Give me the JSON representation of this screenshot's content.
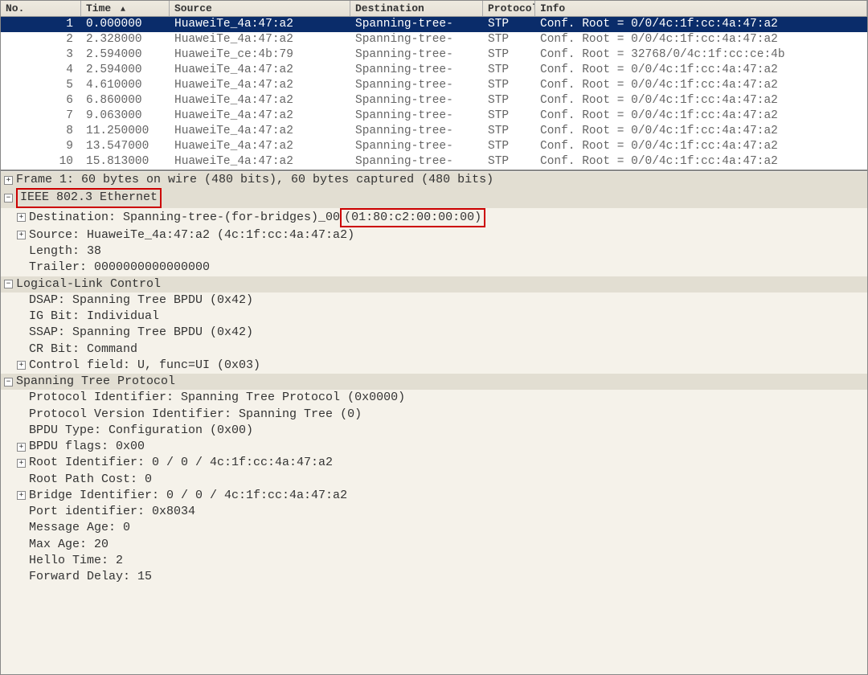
{
  "columns": {
    "no": "No.",
    "time": "Time",
    "source": "Source",
    "destination": "Destination",
    "protocol": "Protocol",
    "info": "Info"
  },
  "packets": [
    {
      "no": "1",
      "time": "0.000000",
      "src": "HuaweiTe_4a:47:a2",
      "dst": "Spanning-tree-",
      "proto": "STP",
      "info": "Conf. Root = 0/0/4c:1f:cc:4a:47:a2",
      "selected": true
    },
    {
      "no": "2",
      "time": "2.328000",
      "src": "HuaweiTe_4a:47:a2",
      "dst": "Spanning-tree-",
      "proto": "STP",
      "info": "Conf. Root = 0/0/4c:1f:cc:4a:47:a2"
    },
    {
      "no": "3",
      "time": "2.594000",
      "src": "HuaweiTe_ce:4b:79",
      "dst": "Spanning-tree-",
      "proto": "STP",
      "info": "Conf. Root = 32768/0/4c:1f:cc:ce:4b"
    },
    {
      "no": "4",
      "time": "2.594000",
      "src": "HuaweiTe_4a:47:a2",
      "dst": "Spanning-tree-",
      "proto": "STP",
      "info": "Conf. Root = 0/0/4c:1f:cc:4a:47:a2"
    },
    {
      "no": "5",
      "time": "4.610000",
      "src": "HuaweiTe_4a:47:a2",
      "dst": "Spanning-tree-",
      "proto": "STP",
      "info": "Conf. Root = 0/0/4c:1f:cc:4a:47:a2"
    },
    {
      "no": "6",
      "time": "6.860000",
      "src": "HuaweiTe_4a:47:a2",
      "dst": "Spanning-tree-",
      "proto": "STP",
      "info": "Conf. Root = 0/0/4c:1f:cc:4a:47:a2"
    },
    {
      "no": "7",
      "time": "9.063000",
      "src": "HuaweiTe_4a:47:a2",
      "dst": "Spanning-tree-",
      "proto": "STP",
      "info": "Conf. Root = 0/0/4c:1f:cc:4a:47:a2"
    },
    {
      "no": "8",
      "time": "11.250000",
      "src": "HuaweiTe_4a:47:a2",
      "dst": "Spanning-tree-",
      "proto": "STP",
      "info": "Conf. Root = 0/0/4c:1f:cc:4a:47:a2"
    },
    {
      "no": "9",
      "time": "13.547000",
      "src": "HuaweiTe_4a:47:a2",
      "dst": "Spanning-tree-",
      "proto": "STP",
      "info": "Conf. Root = 0/0/4c:1f:cc:4a:47:a2"
    },
    {
      "no": "10",
      "time": "15.813000",
      "src": "HuaweiTe_4a:47:a2",
      "dst": "Spanning-tree-",
      "proto": "STP",
      "info": "Conf. Root = 0/0/4c:1f:cc:4a:47:a2"
    }
  ],
  "detail": {
    "frame": "Frame 1: 60 bytes on wire (480 bits), 60 bytes captured (480 bits)",
    "ethernet_label": "IEEE 802.3 Ethernet",
    "eth_dest_pre": "Destination: Spanning-tree-(for-bridges)_00 ",
    "eth_dest_mac": "(01:80:c2:00:00:00)",
    "eth_src": "Source: HuaweiTe_4a:47:a2 (4c:1f:cc:4a:47:a2)",
    "eth_len": "Length: 38",
    "eth_trailer": "Trailer: 0000000000000000",
    "llc_label": "Logical-Link Control",
    "llc_dsap": "DSAP: Spanning Tree BPDU (0x42)",
    "llc_ig": "IG Bit: Individual",
    "llc_ssap": "SSAP: Spanning Tree BPDU (0x42)",
    "llc_cr": "CR Bit: Command",
    "llc_ctrl": "Control field: U, func=UI (0x03)",
    "stp_label": "Spanning Tree Protocol",
    "stp_protoid": "Protocol Identifier: Spanning Tree Protocol (0x0000)",
    "stp_ver": "Protocol Version Identifier: Spanning Tree (0)",
    "stp_bpdutype": "BPDU Type: Configuration (0x00)",
    "stp_flags": "BPDU flags: 0x00",
    "stp_rootid": "Root Identifier: 0 / 0 / 4c:1f:cc:4a:47:a2",
    "stp_rootcost": "Root Path Cost: 0",
    "stp_bridgeid": "Bridge Identifier: 0 / 0 / 4c:1f:cc:4a:47:a2",
    "stp_portid": "Port identifier: 0x8034",
    "stp_msgage": "Message Age: 0",
    "stp_maxage": "Max Age: 20",
    "stp_hello": "Hello Time: 2",
    "stp_fwd": "Forward Delay: 15"
  },
  "glyph": {
    "plus": "+",
    "minus": "−",
    "sort": "▲"
  }
}
